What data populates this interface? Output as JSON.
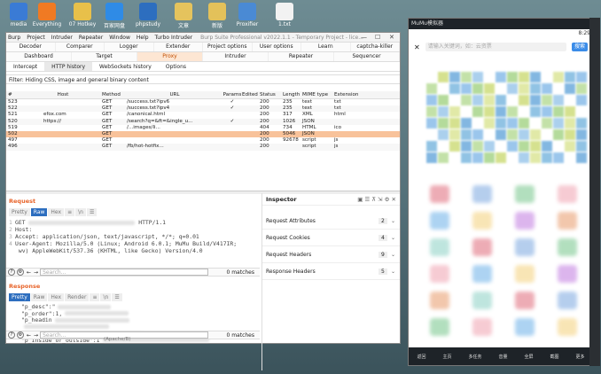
{
  "desktop": {
    "icons": [
      {
        "label": "media",
        "color": "#3a7bd5",
        "icon": "folder-icon"
      },
      {
        "label": "Everything",
        "color": "#f07a23",
        "icon": "search-icon"
      },
      {
        "label": "07 Hotkey",
        "color": "#e8c04a",
        "icon": "folder-icon"
      },
      {
        "label": "百家网盘",
        "color": "#2f8be6",
        "icon": "cloud-icon"
      },
      {
        "label": "phpstudy",
        "color": "#2d6ebf",
        "icon": "p-icon"
      },
      {
        "label": "文章",
        "color": "#e5c35d",
        "icon": "folder-icon"
      },
      {
        "label": "新版",
        "color": "#e3c15a",
        "icon": "folder-icon"
      },
      {
        "label": "Proxifier",
        "color": "#4a8ad4",
        "icon": "proxifier-icon"
      },
      {
        "label": "1.txt",
        "color": "#f2f2f2",
        "icon": "file-icon"
      }
    ]
  },
  "burp": {
    "menu": [
      "Burp",
      "Project",
      "Intruder",
      "Repeater",
      "Window",
      "Help",
      "Turbo Intruder"
    ],
    "title": "Burp Suite Professional v2022.1.1 - Temporary Project - lice...",
    "window_controls": [
      "—",
      "☐",
      "✕"
    ],
    "tabs_row1": [
      "Decoder",
      "Comparer",
      "Logger",
      "Extender",
      "Project options",
      "User options",
      "Learn",
      "captcha-killer"
    ],
    "tabs_row2": [
      "Dashboard",
      "Target",
      "Proxy",
      "Intruder",
      "Repeater",
      "Sequencer"
    ],
    "tabs_row3": [
      "Intercept",
      "HTTP history",
      "WebSockets history",
      "Options"
    ],
    "filter": "Filter: Hiding CSS, image and general binary content",
    "history_headers": [
      "#",
      "Host",
      "Method",
      "URL",
      "Params",
      "Edited",
      "Status",
      "Length",
      "MIME type",
      "Extension"
    ],
    "history_rows": [
      {
        "num": "523",
        "host": "",
        "method": "GET",
        "url": "/success.txt?ipv6",
        "params": "✓",
        "status": "200",
        "length": "235",
        "mime": "text",
        "ext": "txt"
      },
      {
        "num": "522",
        "host": "",
        "method": "GET",
        "url": "/success.txt?ipv4",
        "params": "✓",
        "status": "200",
        "length": "235",
        "mime": "text",
        "ext": "txt"
      },
      {
        "num": "521",
        "host": "efox.com",
        "method": "GET",
        "url": "/canonical.html",
        "params": "",
        "status": "200",
        "length": "317",
        "mime": "XML",
        "ext": "html"
      },
      {
        "num": "520",
        "host": "https://",
        "method": "GET",
        "url": "/search?q=&ft=&ingle_u...",
        "params": "✓",
        "status": "200",
        "length": "1026",
        "mime": "JSON",
        "ext": ""
      },
      {
        "num": "519",
        "host": "",
        "method": "GET",
        "url": "/...images/li...",
        "params": "",
        "status": "404",
        "length": "734",
        "mime": "HTML",
        "ext": "ico"
      },
      {
        "num": "502",
        "host": "",
        "method": "GET",
        "url": "",
        "params": "",
        "status": "200",
        "length": "5046",
        "mime": "JSON",
        "ext": ""
      },
      {
        "num": "497",
        "host": "",
        "method": "GET",
        "url": "",
        "params": "",
        "status": "200",
        "length": "92678",
        "mime": "script",
        "ext": "js"
      },
      {
        "num": "496",
        "host": "",
        "method": "GET",
        "url": "/fb/hot-hotfix...",
        "params": "",
        "status": "200",
        "length": "",
        "mime": "script",
        "ext": "js"
      }
    ],
    "request": {
      "title": "Request",
      "tabs": [
        "Pretty",
        "Raw",
        "Hex"
      ],
      "selected_tab": "Raw",
      "lines": [
        {
          "n": "1",
          "text": "GET ",
          "tail": " HTTP/1.1"
        },
        {
          "n": "2",
          "text": "Host: ",
          "tail": ""
        },
        {
          "n": "3",
          "text": "Accept: application/json, text/javascript, */*; q=0.01",
          "tail": ""
        },
        {
          "n": "4",
          "text": "User-Agent: Mozilla/5.0 (Linux; Android 6.0.1; MuMu Build/V417IR;",
          "tail": ""
        },
        {
          "n": "",
          "text": "  wv) AppleWebKit/537.36 (KHTML, like Gecko) Version/4.0",
          "tail": ""
        }
      ],
      "search_placeholder": "Search...",
      "matches": "0 matches"
    },
    "response": {
      "title": "Response",
      "tabs": [
        "Pretty",
        "Raw",
        "Hex",
        "Render"
      ],
      "selected_tab": "Pretty",
      "lines": [
        "\"p_desc\":\"",
        "\"p_order\":1,",
        "\"p_headin",
        "",
        "sr. jpg",
        "\"p_inside_or_outside\":1"
      ],
      "search_placeholder": "Search...",
      "matches": "0 matches",
      "footer": "(Apache/B)"
    },
    "inspector": {
      "title": "Inspector",
      "sections": [
        {
          "label": "Request Attributes",
          "count": "2"
        },
        {
          "label": "Request Cookies",
          "count": "4"
        },
        {
          "label": "Request Headers",
          "count": "9"
        },
        {
          "label": "Response Headers",
          "count": "5"
        }
      ]
    }
  },
  "mumu": {
    "title": "MuMu模拟器",
    "time": "8:29",
    "search_placeholder": "请输入关键词，如：云资票",
    "search_button": "搜索",
    "nav": [
      "返回",
      "主页",
      "多任务",
      "音量",
      "全屏",
      "截图",
      "更多"
    ]
  }
}
